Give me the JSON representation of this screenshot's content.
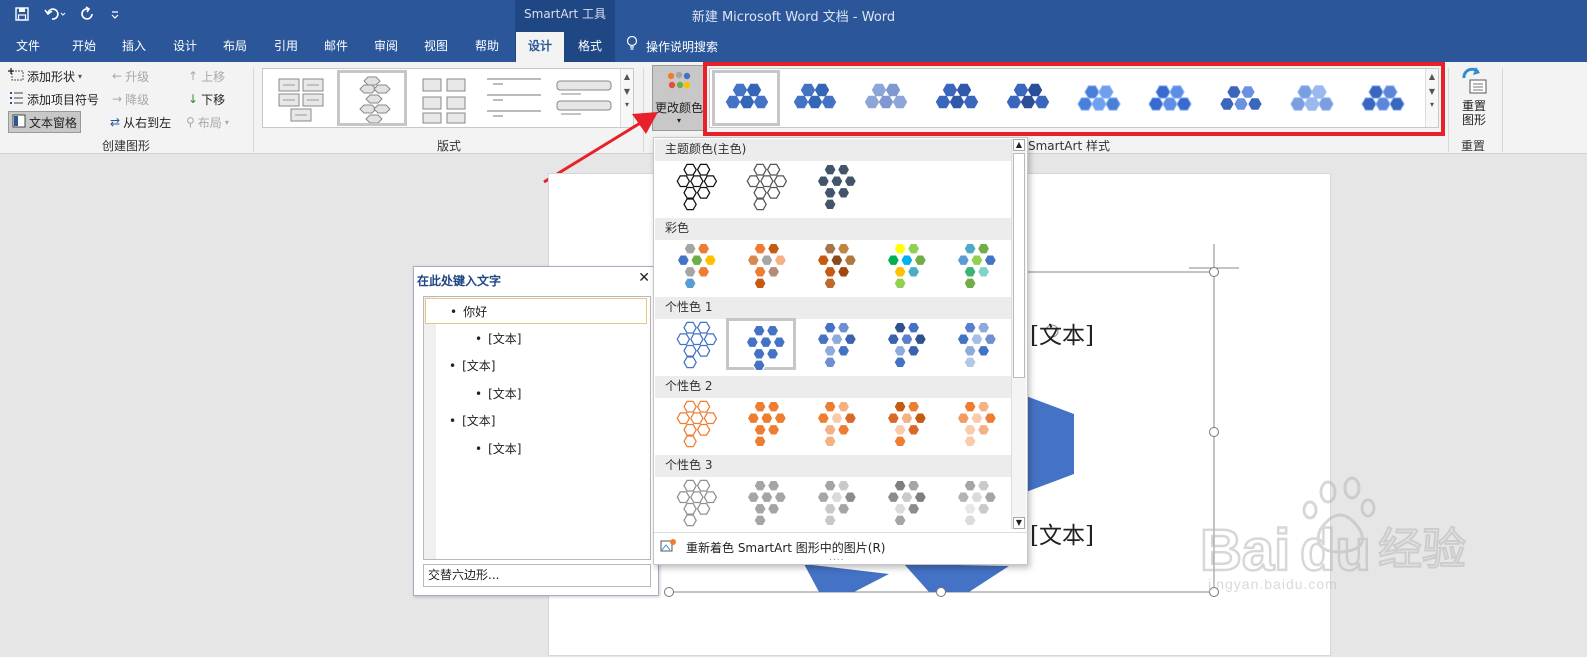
{
  "titlebar": {
    "context_label": "SmartArt 工具",
    "doc_title": "新建 Microsoft Word 文档  -  Word",
    "qat": [
      "save-icon",
      "undo-icon",
      "redo-icon",
      "customize-icon"
    ]
  },
  "tabs": [
    {
      "label": "文件",
      "active": false
    },
    {
      "label": "开始",
      "active": false
    },
    {
      "label": "插入",
      "active": false
    },
    {
      "label": "设计",
      "active": false
    },
    {
      "label": "布局",
      "active": false
    },
    {
      "label": "引用",
      "active": false
    },
    {
      "label": "邮件",
      "active": false
    },
    {
      "label": "审阅",
      "active": false
    },
    {
      "label": "视图",
      "active": false
    },
    {
      "label": "帮助",
      "active": false
    },
    {
      "label": "设计",
      "active": true
    },
    {
      "label": "格式",
      "active": false
    }
  ],
  "tell_me": "操作说明搜索",
  "ribbon": {
    "create": {
      "add_shape": "添加形状",
      "add_bullet": "添加项目符号",
      "text_pane": "文本窗格",
      "promote": "升级",
      "demote": "降级",
      "rtl": "从右到左",
      "move_up": "上移",
      "move_down": "下移",
      "layout": "布局",
      "group_label": "创建图形"
    },
    "layouts_label": "版式",
    "change_colors": "更改颜色",
    "styles_label": "SmartArt 样式",
    "reset_graphic": "重置图形",
    "reset_label": "重置"
  },
  "text_pane": {
    "title": "在此处键入文字",
    "items": [
      {
        "level": 1,
        "text": "你好"
      },
      {
        "level": 2,
        "text": "[文本]"
      },
      {
        "level": 1,
        "text": "[文本]"
      },
      {
        "level": 2,
        "text": "[文本]"
      },
      {
        "level": 1,
        "text": "[文本]"
      },
      {
        "level": 2,
        "text": "[文本]"
      }
    ],
    "footer": "交替六边形..."
  },
  "color_panel": {
    "sections": [
      "主题颜色(主色)",
      "彩色",
      "个性色 1",
      "个性色 2",
      "个性色 3"
    ],
    "footer_label": "重新着色 SmartArt 图形中的图片",
    "footer_key": "(R)"
  },
  "canvas": {
    "text1": "[文本]",
    "text2": "[文本]"
  },
  "watermark": {
    "logo": "Baidu经验",
    "url": "jingyan.baidu.com"
  },
  "colors": {
    "word_blue": "#2b579a",
    "accent1": "#4472c4",
    "accent2": "#ed7d31",
    "accent3": "#a5a5a5",
    "highlight_red": "#e8202a"
  }
}
